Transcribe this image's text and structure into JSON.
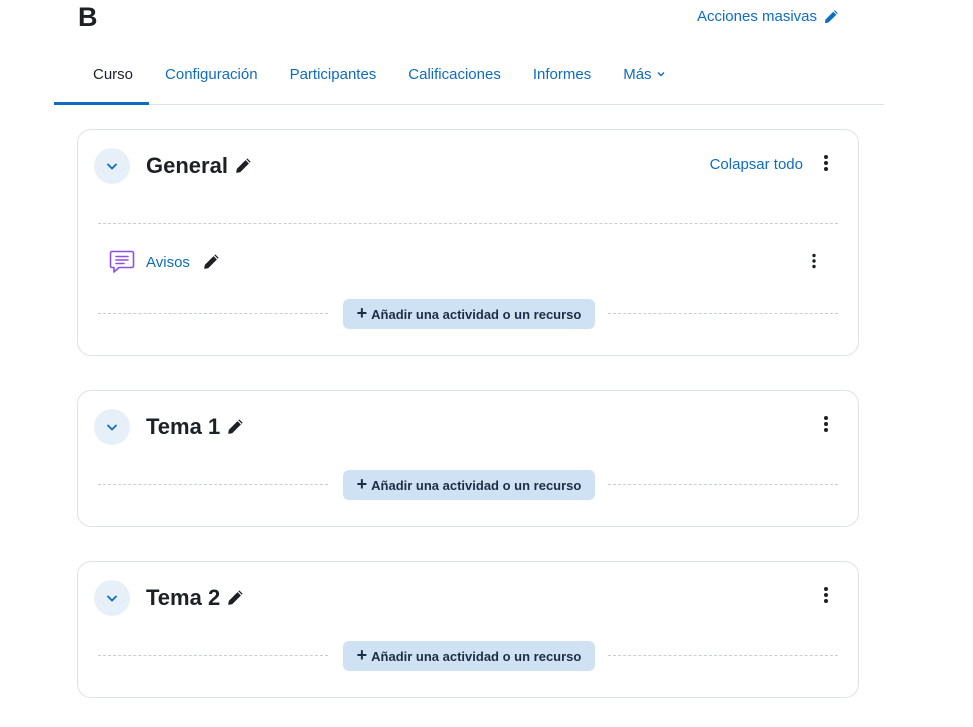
{
  "header": {
    "course_title": "B",
    "bulk_actions_label": "Acciones masivas"
  },
  "tabs": [
    {
      "label": "Curso",
      "active": true
    },
    {
      "label": "Configuración",
      "active": false
    },
    {
      "label": "Participantes",
      "active": false
    },
    {
      "label": "Calificaciones",
      "active": false
    },
    {
      "label": "Informes",
      "active": false
    },
    {
      "label": "Más",
      "active": false,
      "has_dropdown": true
    }
  ],
  "sections": [
    {
      "title": "General",
      "collapse_all_label": "Colapsar todo",
      "activities": [
        {
          "name": "Avisos",
          "icon": "forum-icon"
        }
      ],
      "add_label": "Añadir una actividad o un recurso"
    },
    {
      "title": "Tema 1",
      "activities": [],
      "add_label": "Añadir una actividad o un recurso"
    },
    {
      "title": "Tema 2",
      "activities": [],
      "add_label": "Añadir una actividad o un recurso"
    }
  ],
  "colors": {
    "link": "#0f6cbf",
    "text": "#1d2125",
    "add_button_bg": "#cfe2f3",
    "collapse_button_bg": "#e7eff8",
    "forum_icon": "#8f4fe2"
  }
}
